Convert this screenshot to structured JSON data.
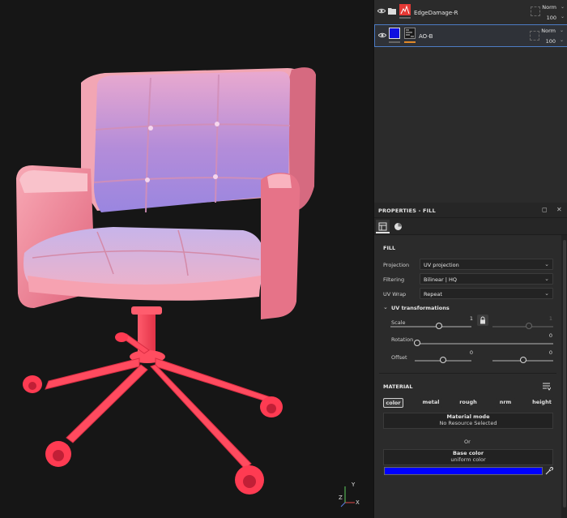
{
  "viewport": {
    "axis": {
      "x": "X",
      "y": "Y",
      "z": "Z"
    }
  },
  "layers": [
    {
      "name": "EdgeDamage-R",
      "blend": "Norm",
      "opacity": "100",
      "icon": "folder-icon",
      "thumb_color": "#e53935"
    },
    {
      "name": "AO-B",
      "blend": "Norm",
      "opacity": "100",
      "icon": "fill-layer-icon",
      "thumb_color": "#1010e0"
    }
  ],
  "properties": {
    "title": "PROPERTIES - FILL",
    "fill": {
      "section": "FILL",
      "projection_label": "Projection",
      "projection_value": "UV projection",
      "filtering_label": "Filtering",
      "filtering_value": "Bilinear | HQ",
      "uvwrap_label": "UV Wrap",
      "uvwrap_value": "Repeat",
      "uvtransform_section": "UV transformations",
      "scale_label": "Scale",
      "scale_value": "1",
      "scale_value2": "1",
      "scale_level": 0.6,
      "scale2_level": 0.6,
      "rotation_label": "Rotation",
      "rotation_value": "0",
      "rotation_level": 0.0,
      "offset_label": "Offset",
      "offset_value": "0",
      "offset_value2": "0",
      "offset_level": 0.5,
      "offset2_level": 0.5
    },
    "material": {
      "section": "MATERIAL",
      "channels": [
        "color",
        "metal",
        "rough",
        "nrm",
        "height"
      ],
      "active_channel": "color",
      "mode_title": "Material mode",
      "mode_sub": "No Resource Selected",
      "or": "Or",
      "base_title": "Base color",
      "base_sub": "uniform color",
      "base_color": "#0000ff"
    }
  }
}
